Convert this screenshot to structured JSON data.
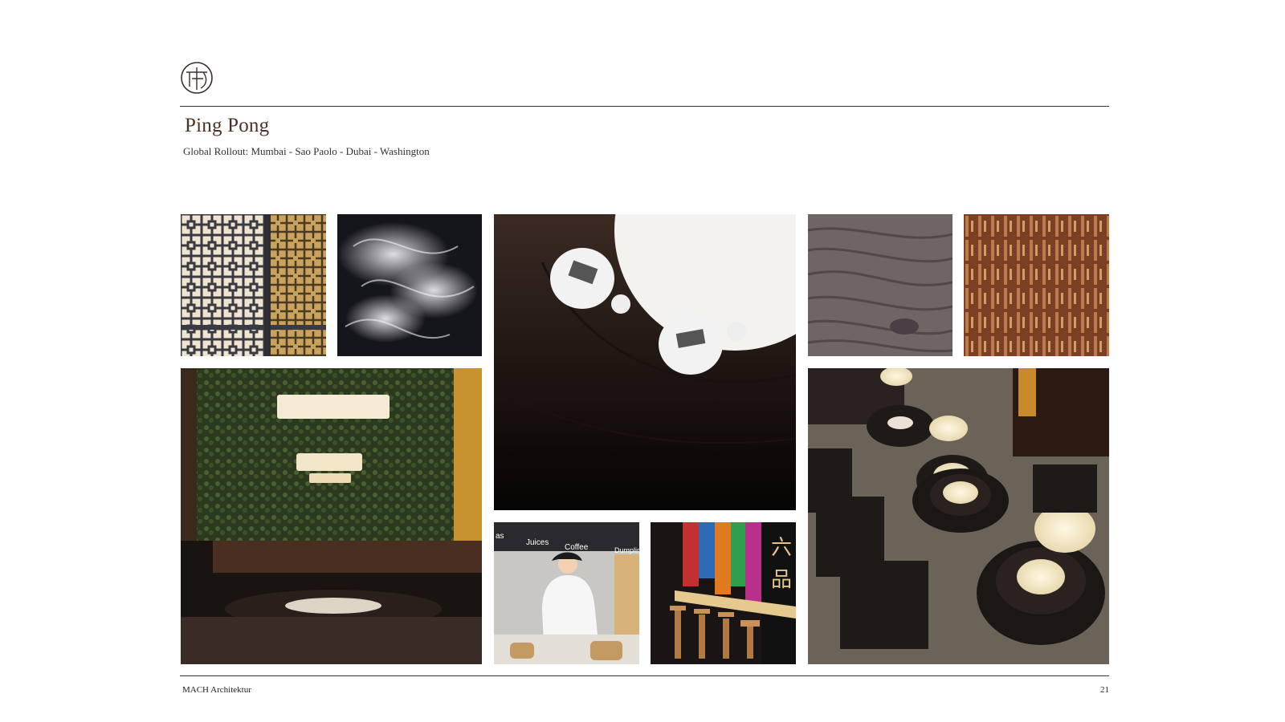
{
  "header": {
    "logo_icon": "circular-monogram-logo"
  },
  "title": "Ping Pong",
  "subtitle": "Global Rollout: Mumbai - Sao Paolo - Dubai - Washington",
  "photos": {
    "lattice_screen": "lattice-screen-photo",
    "smoke": "smoke-photo",
    "table_place_settings": "table-place-settings-photo",
    "wood_grain": "wood-grain-texture-photo",
    "wood_wall_panels": "wood-wall-panels-photo",
    "green_wall_dining": "green-wall-dining-photo",
    "chef": "chef-dumpling-counter-photo",
    "bar_stools": "bar-stools-photo",
    "dining_overhead": "dining-overhead-photo"
  },
  "chef_photo_signs": {
    "sign_1": "as",
    "sign_2": "Juices",
    "sign_3": "Coffee",
    "sign_4": "Dumplings"
  },
  "footer": {
    "company": "MACH Architektur",
    "page_number": "21"
  }
}
